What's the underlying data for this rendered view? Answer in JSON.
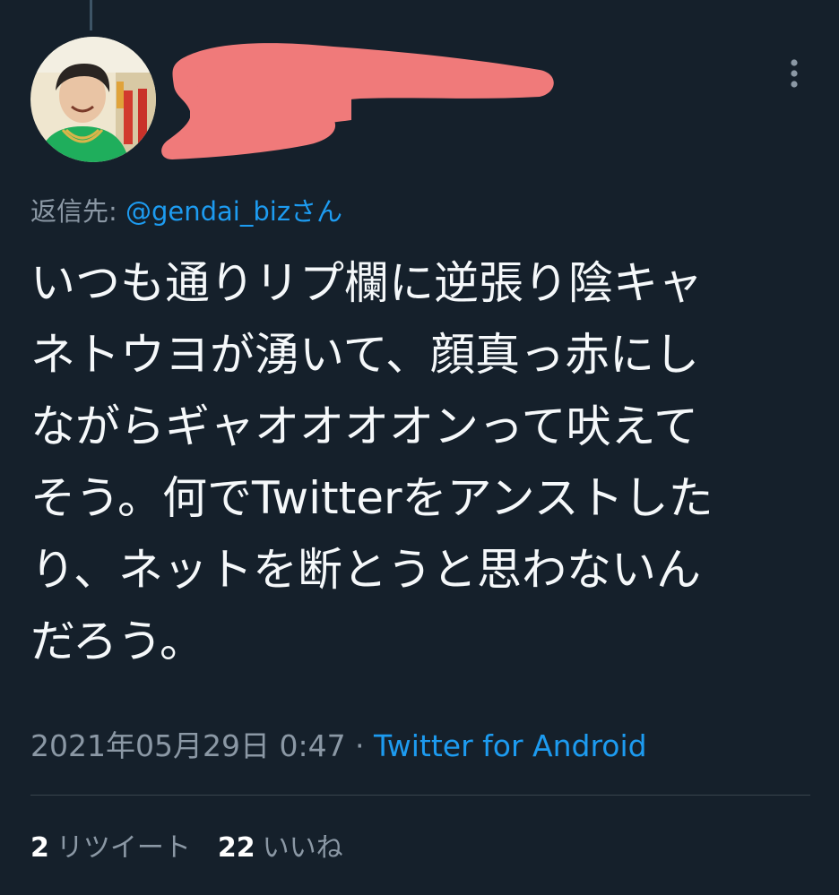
{
  "tweet": {
    "reply_prefix": "返信先: ",
    "reply_handle": "@gendai_bizさん",
    "text_lines": [
      "いつも通りリプ欄に逆張り陰キャ",
      "ネトウヨが湧いて、顔真っ赤にし",
      "ながらギャオオオオンって吠えて",
      "そう。何でTwitterをアンストした",
      "り、ネットを断とうと思わないん",
      "だろう。"
    ],
    "timestamp": "2021年05月29日 0:47",
    "separator": " · ",
    "source": "Twitter for Android"
  },
  "stats": {
    "retweets": {
      "count": "2",
      "label": "リツイート"
    },
    "likes": {
      "count": "22",
      "label": "いいね"
    }
  },
  "icons": {
    "more": "more-vertical-icon"
  },
  "colors": {
    "background": "#15202b",
    "accent": "#1d9bf0",
    "muted": "#8b98a5",
    "redaction": "#f07a7a"
  }
}
